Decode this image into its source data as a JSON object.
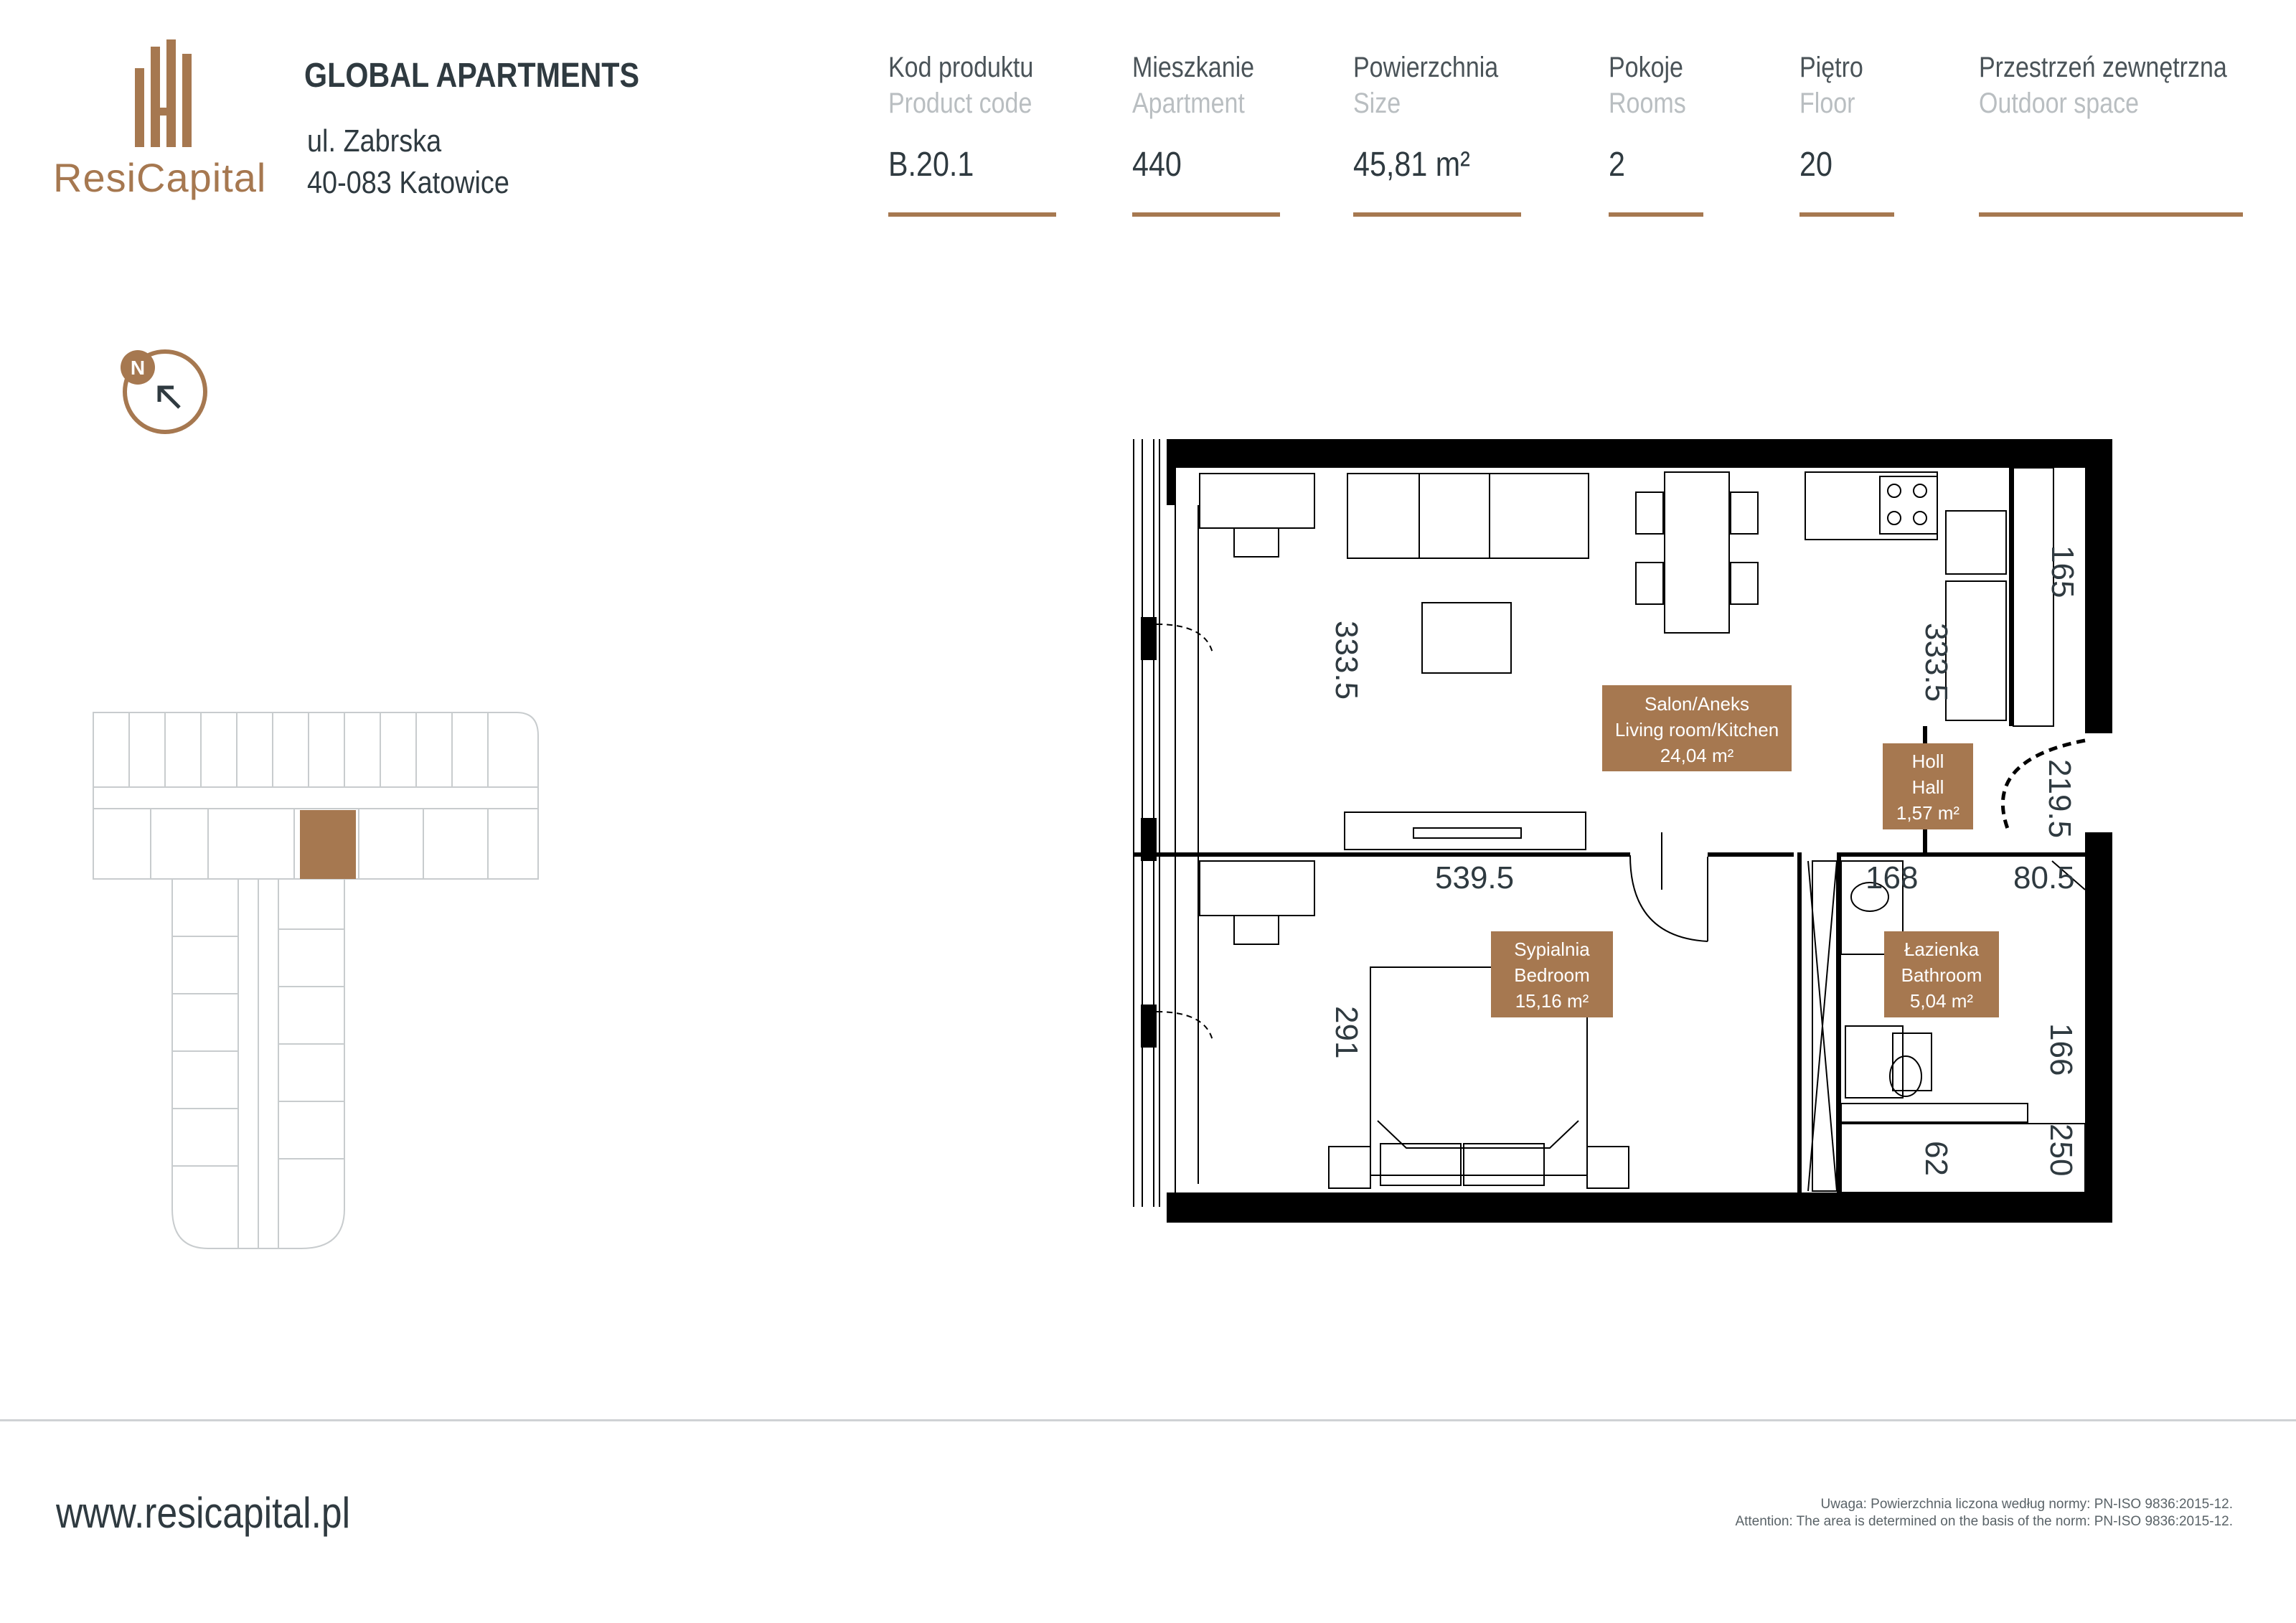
{
  "brand": {
    "name": "ResiCapital",
    "accent_color": "#a67850",
    "text_color": "#2f3a40"
  },
  "address": {
    "project": "GLOBAL APARTMENTS",
    "street": "ul. Zabrska",
    "city": "40-083 Katowice"
  },
  "specs": [
    {
      "label_pl": "Kod produktu",
      "label_en": "Product code",
      "value": "B.20.1"
    },
    {
      "label_pl": "Mieszkanie",
      "label_en": "Apartment",
      "value": "440"
    },
    {
      "label_pl": "Powierzchnia",
      "label_en": "Size",
      "value": "45,81 m²"
    },
    {
      "label_pl": "Pokoje",
      "label_en": "Rooms",
      "value": "2"
    },
    {
      "label_pl": "Piętro",
      "label_en": "Floor",
      "value": "20"
    },
    {
      "label_pl": "Przestrzeń zewnętrzna",
      "label_en": "Outdoor space",
      "value": ""
    }
  ],
  "compass": {
    "letter": "N",
    "icon": "north-arrow-icon"
  },
  "rooms": [
    {
      "name_pl": "Salon/Aneks",
      "name_en": "Living room/Kitchen",
      "area": "24,04 m²"
    },
    {
      "name_pl": "Holl",
      "name_en": "Hall",
      "area": "1,57 m²"
    },
    {
      "name_pl": "Sypialnia",
      "name_en": "Bedroom",
      "area": "15,16 m²"
    },
    {
      "name_pl": "Łazienka",
      "name_en": "Bathroom",
      "area": "5,04 m²"
    }
  ],
  "dimensions": {
    "living_height": "333.5",
    "living_width": "539.5",
    "kitchen_top": "165",
    "kitchen_side": "333.5",
    "door_width": "219.5",
    "bath_width": "168",
    "bath_side": "80.5",
    "bedroom_height": "291",
    "bath_height": "166",
    "bath_bottom": "62",
    "bath_corner": "250"
  },
  "footer": {
    "website": "www.resicapital.pl",
    "note_pl": "Uwaga: Powierzchnia liczona według normy: PN-ISO 9836:2015-12.",
    "note_en": "Attention: The area is determined on the basis of the norm: PN-ISO 9836:2015-12."
  }
}
